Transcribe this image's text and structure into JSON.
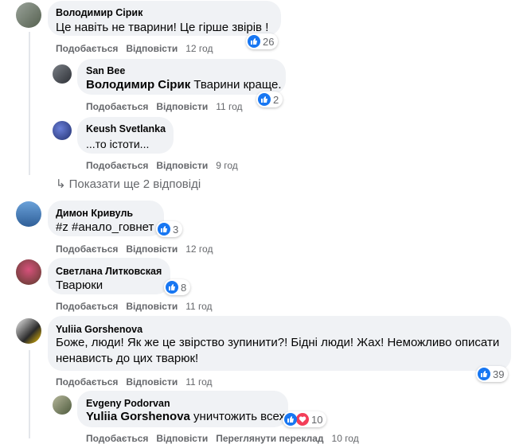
{
  "comments": [
    {
      "author": "Володимир Сірик",
      "text": "Це навіть не тварини! Це гірше звірів !",
      "reactions": "26",
      "like": "Подобається",
      "reply": "Відповісти",
      "time": "12 год"
    },
    {
      "author": "San Bee",
      "mention": "Володимир Сірик",
      "text": " Тварини краще.",
      "reactions": "2",
      "like": "Подобається",
      "reply": "Відповісти",
      "time": "11 год"
    },
    {
      "author": "Keush Svetlanka",
      "text": "...то істоти...",
      "like": "Подобається",
      "reply": "Відповісти",
      "time": "9 год"
    },
    {
      "author": "Димон Кривуль",
      "text": "#z #анало_говнет",
      "reactions": "3",
      "like": "Подобається",
      "reply": "Відповісти",
      "time": "12 год"
    },
    {
      "author": "Светлана Литковская",
      "text": "Тварюки",
      "reactions": "8",
      "like": "Подобається",
      "reply": "Відповісти",
      "time": "11 год"
    },
    {
      "author": "Yuliia Gorshenova",
      "text_line1": "Боже, люди! Як же це звірство зупинити?! Бідні люди! Жах! Неможливо описати",
      "text_line2": "ненависть до цих тварюк!",
      "reactions": "39",
      "like": "Подобається",
      "reply": "Відповісти",
      "time": "11 год"
    },
    {
      "author": "Evgeny Podorvan",
      "mention": "Yuliia Gorshenova",
      "text": " уничтожить всех",
      "reactions": "10",
      "like": "Подобається",
      "reply": "Відповісти",
      "see_translation": "Переглянути переклад",
      "time": "10 год"
    }
  ],
  "show_more_replies": "Показати ще 2 відповіді",
  "colors": {
    "like": "#1877f2",
    "love": "#f33e58",
    "bubble": "#f0f2f5",
    "meta": "#65676b"
  }
}
